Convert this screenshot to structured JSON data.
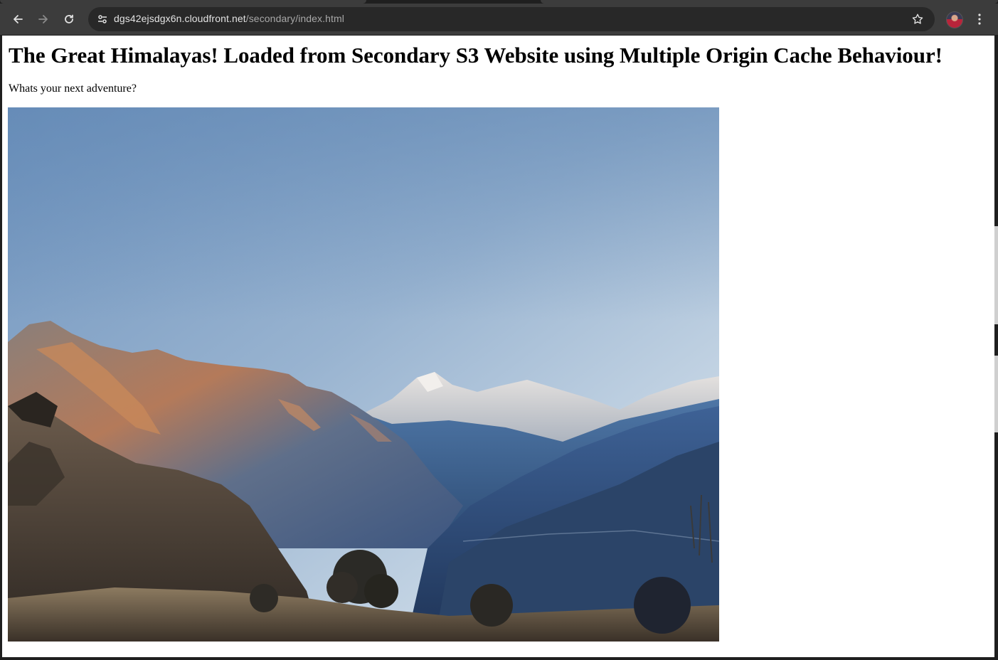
{
  "browser": {
    "url_host": "dgs42ejsdgx6n.cloudfront.net",
    "url_path": "/secondary/index.html",
    "icons": {
      "back": "arrow-left-icon",
      "forward": "arrow-right-icon",
      "reload": "reload-icon",
      "site_info": "tune-icon",
      "bookmark": "star-icon",
      "profile": "avatar",
      "menu": "kebab-menu-icon"
    }
  },
  "page": {
    "title": "The Great Himalayas! Loaded from Secondary S3 Website using Multiple Origin Cache Behaviour!",
    "subtitle": "Whats your next adventure?"
  },
  "colors": {
    "browser_toolbar": "#3c3c3c",
    "omnibox": "#282828",
    "page_background": "#ffffff",
    "text": "#000000"
  }
}
